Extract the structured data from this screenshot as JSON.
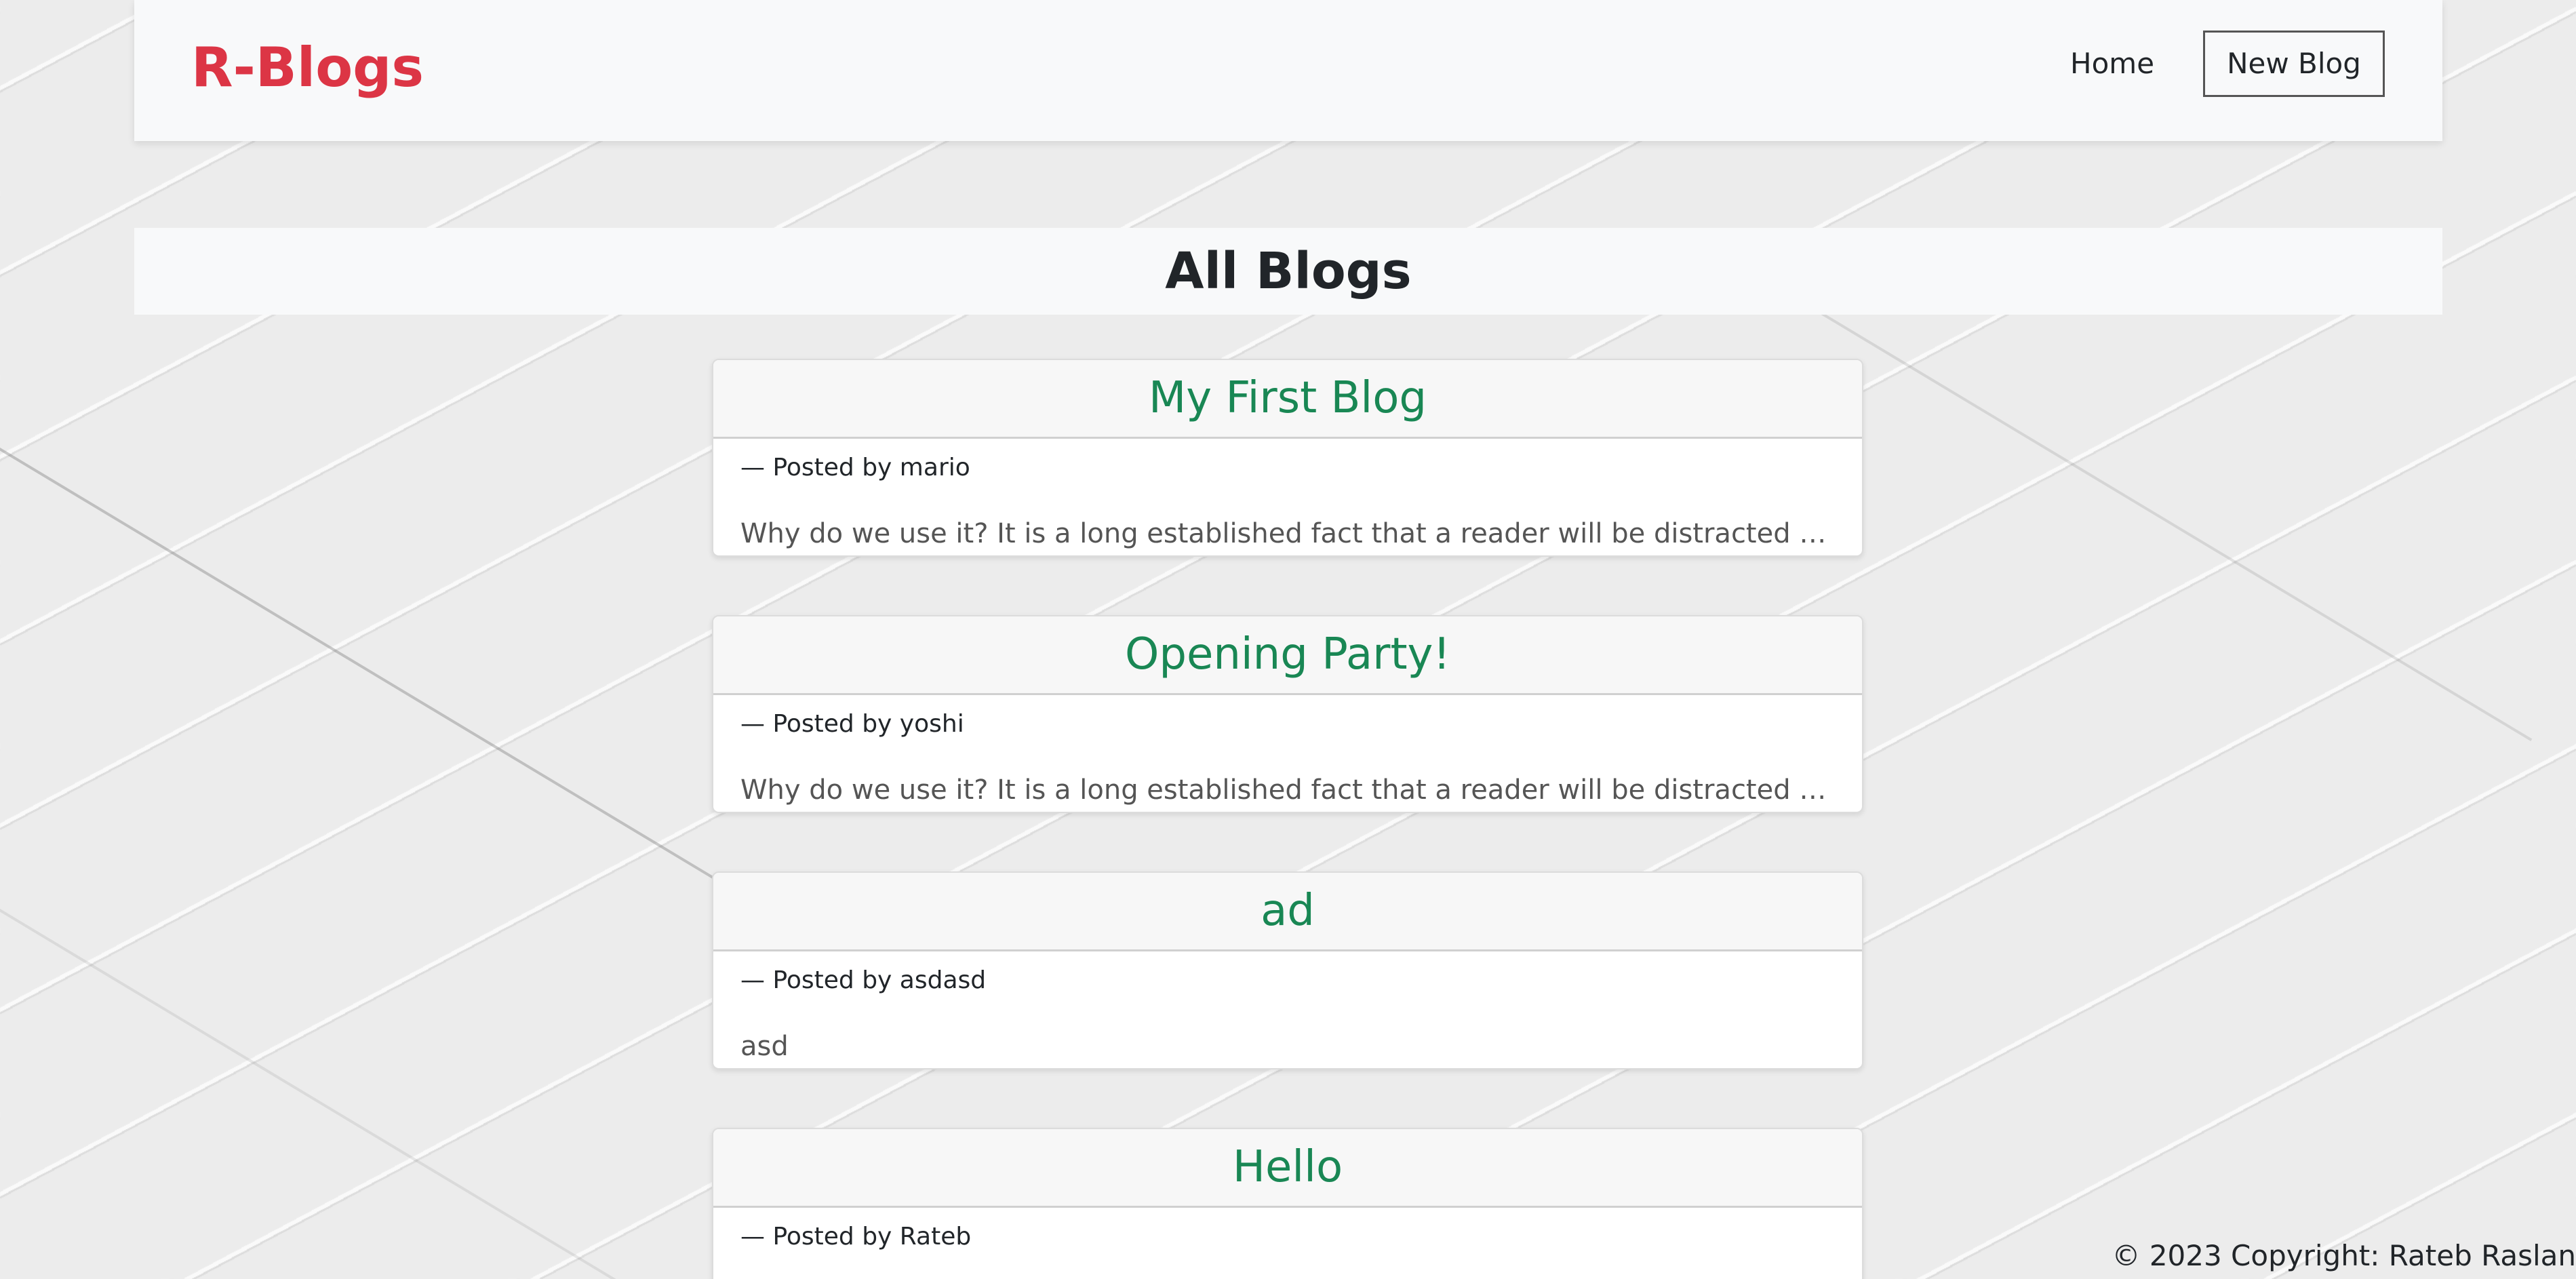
{
  "navbar": {
    "brand": "R-Blogs",
    "home_label": "Home",
    "new_blog_label": "New Blog"
  },
  "main": {
    "title": "All Blogs",
    "blogs": [
      {
        "title": "My First Blog",
        "author_line": "— Posted by mario",
        "snippet": "Why do we use it? It is a long established fact that a reader will be distracted by the reada..."
      },
      {
        "title": "Opening Party!",
        "author_line": "— Posted by yoshi",
        "snippet": "Why do we use it? It is a long established fact that a reader will be distracted by the reada..."
      },
      {
        "title": "ad",
        "author_line": "— Posted by asdasd",
        "snippet": "asd"
      },
      {
        "title": "Hello",
        "author_line": "— Posted by Rateb",
        "snippet": ""
      }
    ]
  },
  "footer": {
    "copyright": "© 2023 Copyright: Rateb Raslan"
  },
  "colors": {
    "brand": "#dc3545",
    "blog_title": "#198754",
    "navbar_bg": "#f8f9fa"
  }
}
